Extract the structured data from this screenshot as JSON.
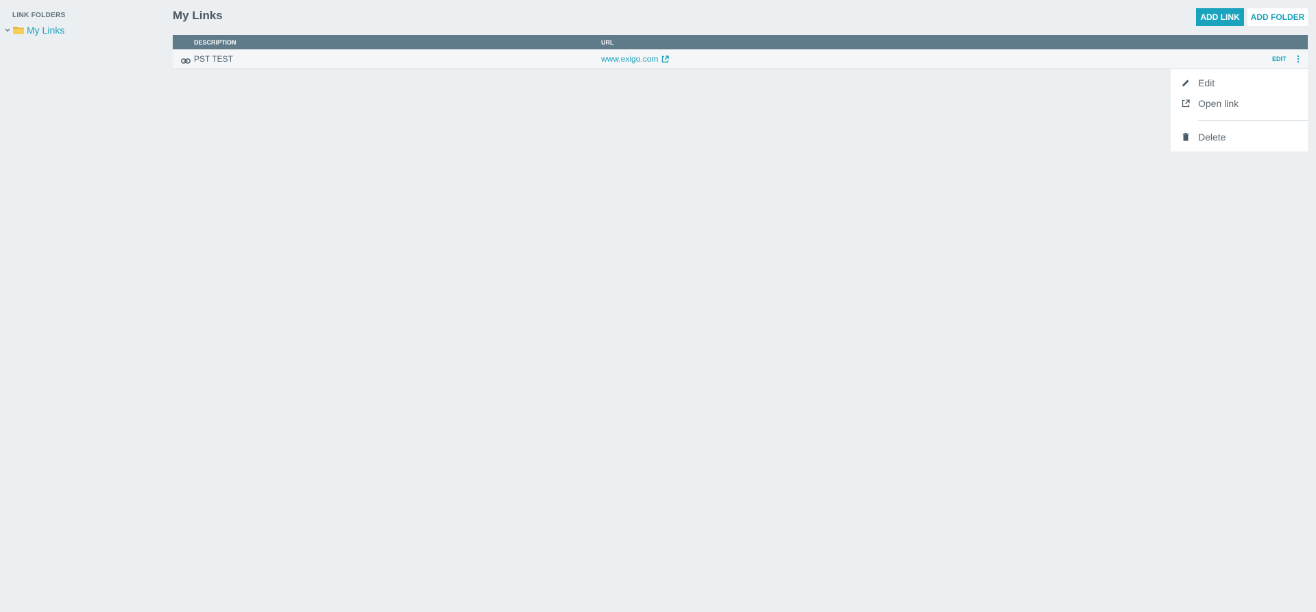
{
  "sidebar": {
    "heading": "LINK FOLDERS",
    "folders": [
      {
        "label": "My Links",
        "expanded": true
      }
    ]
  },
  "main": {
    "title": "My Links",
    "buttons": {
      "add_link": "ADD LINK",
      "add_folder": "ADD FOLDER"
    },
    "table": {
      "columns": [
        "DESCRIPTION",
        "URL"
      ],
      "rows": [
        {
          "description": "PST TEST",
          "url": "www.exigo.com",
          "edit_label": "EDIT"
        }
      ]
    }
  },
  "context_menu": {
    "items": [
      {
        "label": "Edit",
        "icon": "pencil-icon"
      },
      {
        "label": "Open link",
        "icon": "external-link-icon"
      },
      {
        "label": "Delete",
        "icon": "trash-icon"
      }
    ]
  },
  "colors": {
    "accent": "#1aa3bd",
    "header_bg": "#5f7a89",
    "page_bg": "#ebeff1"
  }
}
